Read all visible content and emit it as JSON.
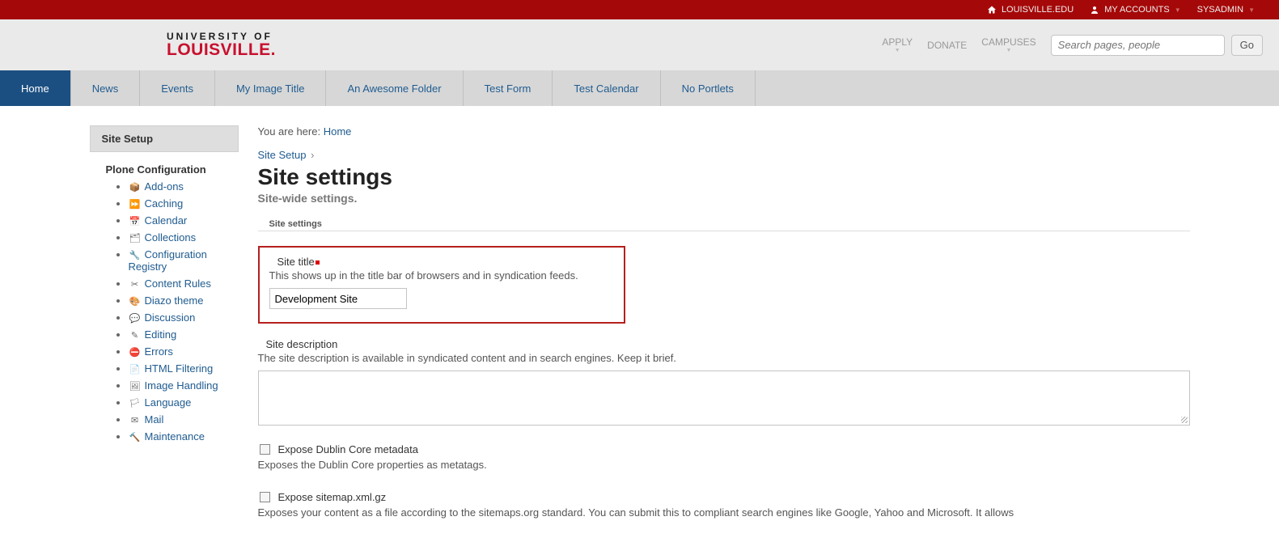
{
  "topbar": {
    "home_link": "LOUISVILLE.EDU",
    "accounts": "MY ACCOUNTS",
    "user": "SYSADMIN"
  },
  "logo": {
    "top": "UNIVERSITY OF",
    "bottom": "LOUISVILLE."
  },
  "header_links": {
    "apply": "APPLY",
    "donate": "DONATE",
    "campuses": "CAMPUSES"
  },
  "search": {
    "placeholder": "Search pages, people",
    "go": "Go"
  },
  "nav": [
    {
      "label": "Home",
      "active": true
    },
    {
      "label": "News"
    },
    {
      "label": "Events"
    },
    {
      "label": "My Image Title"
    },
    {
      "label": "An Awesome Folder"
    },
    {
      "label": "Test Form"
    },
    {
      "label": "Test Calendar"
    },
    {
      "label": "No Portlets"
    }
  ],
  "sidebar": {
    "header": "Site Setup",
    "section_title": "Plone Configuration",
    "items": [
      {
        "label": "Add-ons",
        "icon": "📦"
      },
      {
        "label": "Caching",
        "icon": "⏩"
      },
      {
        "label": "Calendar",
        "icon": "📅"
      },
      {
        "label": "Collections",
        "icon": "🗂"
      },
      {
        "label": "Configuration Registry",
        "icon": "🔧"
      },
      {
        "label": "Content Rules",
        "icon": "✂"
      },
      {
        "label": "Diazo theme",
        "icon": "🎨"
      },
      {
        "label": "Discussion",
        "icon": "💬"
      },
      {
        "label": "Editing",
        "icon": "✎"
      },
      {
        "label": "Errors",
        "icon": "⛔"
      },
      {
        "label": "HTML Filtering",
        "icon": "📄"
      },
      {
        "label": "Image Handling",
        "icon": "🖼"
      },
      {
        "label": "Language",
        "icon": "🏳"
      },
      {
        "label": "Mail",
        "icon": "✉"
      },
      {
        "label": "Maintenance",
        "icon": "🔨"
      }
    ]
  },
  "breadcrumb": {
    "prefix": "You are here:",
    "home": "Home"
  },
  "setup_path": {
    "link": "Site Setup",
    "caret": "›"
  },
  "page": {
    "title": "Site settings",
    "subtitle": "Site-wide settings.",
    "section_label": "Site settings"
  },
  "fields": {
    "site_title": {
      "label": "Site title",
      "help": "This shows up in the title bar of browsers and in syndication feeds.",
      "value": "Development Site"
    },
    "site_description": {
      "label": "Site description",
      "help": "The site description is available in syndicated content and in search engines. Keep it brief.",
      "value": ""
    },
    "dublin_core": {
      "label": "Expose Dublin Core metadata",
      "help": "Exposes the Dublin Core properties as metatags."
    },
    "sitemap": {
      "label": "Expose sitemap.xml.gz",
      "help": "Exposes your content as a file according to the sitemaps.org standard. You can submit this to compliant search engines like Google, Yahoo and Microsoft. It allows"
    }
  }
}
